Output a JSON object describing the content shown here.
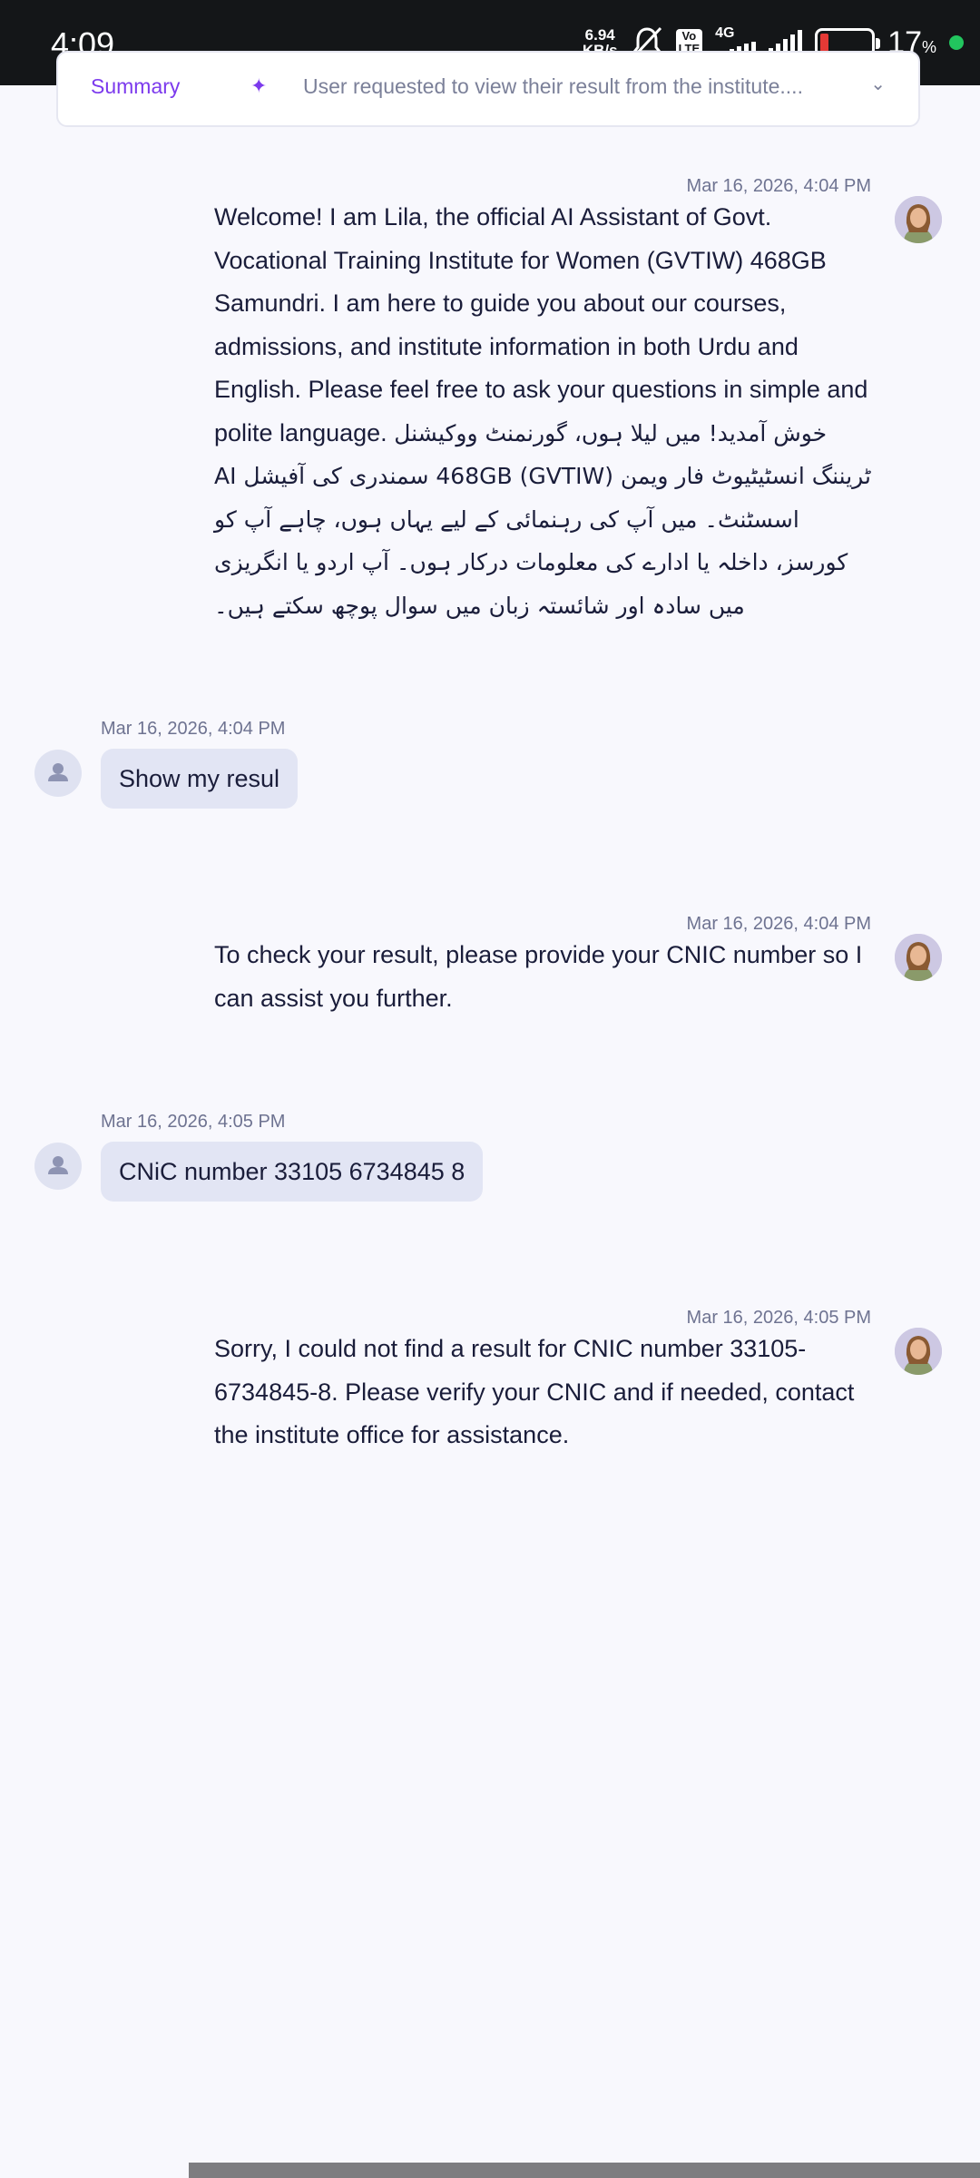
{
  "status_bar": {
    "time": "4:09",
    "net_speed_value": "6.94",
    "net_speed_unit": "KB/s",
    "volte_top": "Vo",
    "volte_bottom": "LTE",
    "network": "4G",
    "battery_percent": "17",
    "battery_unit": "%",
    "battery_level": 0.17,
    "icons": [
      "bell-off-icon",
      "signal-icon",
      "battery-icon"
    ]
  },
  "summary": {
    "label": "Summary",
    "spark": "✦",
    "text": "User requested to view their result from the institute....",
    "chevron": "⌄"
  },
  "messages": [
    {
      "sender": "assistant",
      "timestamp": "Mar 16, 2026, 4:04 PM",
      "text": "Welcome! I am Lila, the official AI Assistant of Govt. Vocational Training Institute for Women (GVTIW) 468GB Samundri. I am here to guide you about our courses, admissions, and institute information in both Urdu and English. Please feel free to ask your questions in simple and polite language.",
      "text_urdu": "خوش آمدید! میں لیلا ہوں، گورنمنٹ ووکیشنل ٹریننگ انسٹیٹیوٹ فار ویمن (GVTIW) 468GB سمندری کی آفیشل AI اسسٹنٹ۔ میں آپ کی رہنمائی کے لیے یہاں ہوں، چاہے آپ کو کورسز، داخلہ یا ادارے کی معلومات درکار ہوں۔ آپ اردو یا انگریزی میں سادہ اور شائستہ زبان میں سوال پوچھ سکتے ہیں۔"
    },
    {
      "sender": "user",
      "timestamp": "Mar 16, 2026, 4:04 PM",
      "text": "Show my resul"
    },
    {
      "sender": "assistant",
      "timestamp": "Mar 16, 2026, 4:04 PM",
      "text": "To check your result, please provide your CNIC number so I can assist you further."
    },
    {
      "sender": "user",
      "timestamp": "Mar 16, 2026, 4:05 PM",
      "text": "CNiC number 33105 6734845 8"
    },
    {
      "sender": "assistant",
      "timestamp": "Mar 16, 2026, 4:05 PM",
      "text": "Sorry, I could not find a result for CNIC number 33105-6734845-8. Please verify your CNIC and if needed, contact the institute office for assistance."
    }
  ],
  "colors": {
    "background": "#f8f8fd",
    "accent": "#7c3aed",
    "user_bubble": "#e2e5f4",
    "status_bar": "#141618",
    "battery_low": "#e53935",
    "online_dot": "#22c55e"
  }
}
